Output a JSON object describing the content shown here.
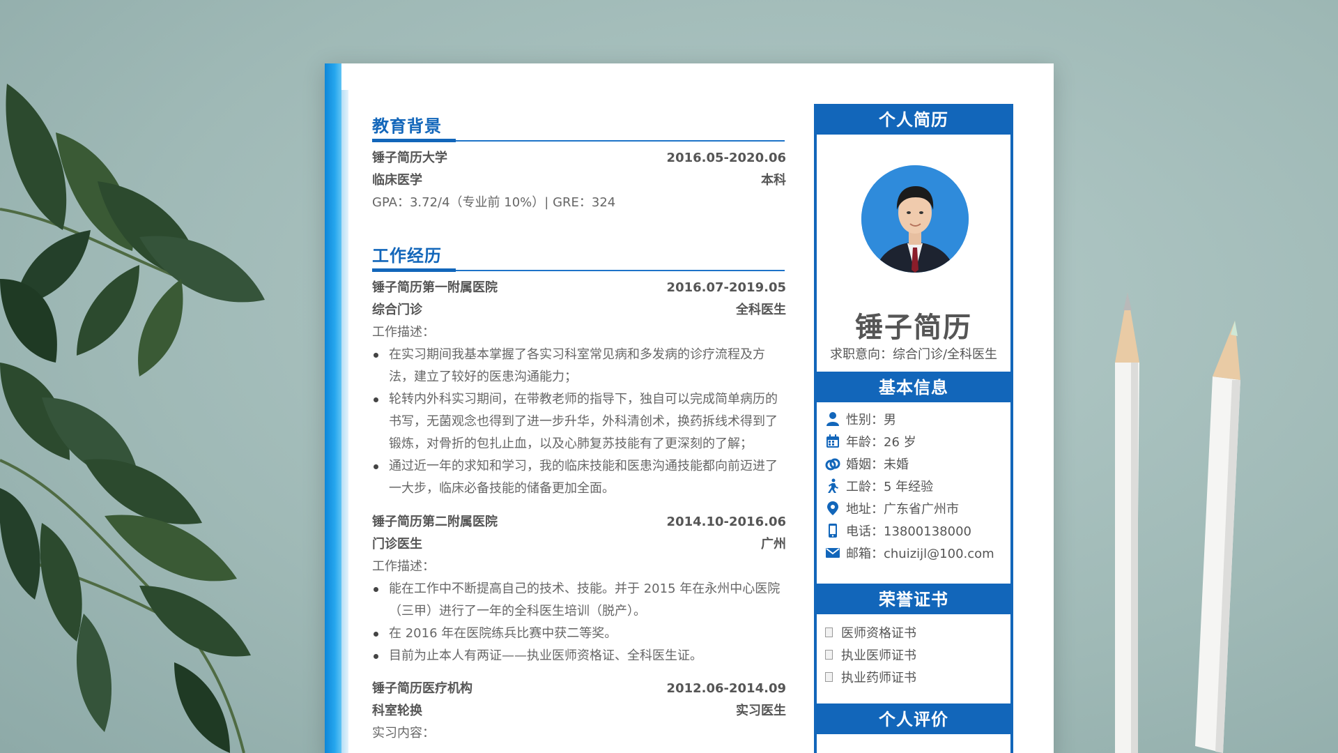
{
  "education": {
    "title": "教育背景",
    "school": "锤子简历大学",
    "period": "2016.05-2020.06",
    "major": "临床医学",
    "degree": "本科",
    "scores": "GPA：3.72/4（专业前 10%）| GRE：324"
  },
  "work": {
    "title": "工作经历",
    "jobs": [
      {
        "org": "锤子简历第一附属医院",
        "period": "2016.07-2019.05",
        "dept": "综合门诊",
        "role": "全科医生",
        "desc_label": "工作描述：",
        "bullets": [
          [
            "在实习期间我基本掌握了各实习科室常见病和多发病的诊疗流程及方",
            "法，建立了较好的医患沟通能力；"
          ],
          [
            "轮转内外科实习期间，在带教老师的指导下，独自可以完成简单病历的",
            "书写，无菌观念也得到了进一步升华，外科清创术，换药拆线术得到了",
            "锻炼，对骨折的包扎止血，以及心肺复苏技能有了更深刻的了解；"
          ],
          [
            "通过近一年的求知和学习，我的临床技能和医患沟通技能都向前迈进了",
            "一大步，临床必备技能的储备更加全面。"
          ]
        ]
      },
      {
        "org": "锤子简历第二附属医院",
        "period": "2014.10-2016.06",
        "dept": "门诊医生",
        "role": "广州",
        "desc_label": "工作描述：",
        "bullets": [
          [
            "能在工作中不断提高自己的技术、技能。并于 2015 年在永州中心医院",
            "（三甲）进行了一年的全科医生培训（脱产）。"
          ],
          [
            "在 2016 年在医院练兵比赛中获二等奖。"
          ],
          [
            "目前为止本人有两证——执业医师资格证、全科医生证。"
          ]
        ]
      },
      {
        "org": "锤子简历医疗机构",
        "period": "2012.06-2014.09",
        "dept": "科室轮换",
        "role": "实习医生",
        "desc_label": "实习内容："
      }
    ]
  },
  "profile": {
    "header": "个人简历",
    "name": "锤子简历",
    "intent": "求职意向：综合门诊/全科医生"
  },
  "basic": {
    "header": "基本信息",
    "items": [
      {
        "icon": "person-icon",
        "text": "性别：男"
      },
      {
        "icon": "calendar-icon",
        "text": "年龄：26 岁"
      },
      {
        "icon": "rings-icon",
        "text": "婚姻：未婚"
      },
      {
        "icon": "walking-icon",
        "text": "工龄：5 年经验"
      },
      {
        "icon": "location-pin-icon",
        "text": "地址：广东省广州市"
      },
      {
        "icon": "phone-icon",
        "text": "电话：13800138000"
      },
      {
        "icon": "mail-icon",
        "text": "邮箱：chuizijl@100.com"
      }
    ]
  },
  "honors": {
    "header": "荣誉证书",
    "items": [
      "医师资格证书",
      "执业医师证书",
      "执业药师证书"
    ]
  },
  "evaluation": {
    "header": "个人评价"
  },
  "colors": {
    "accent": "#1266ba",
    "background": "#a6c0bd"
  }
}
